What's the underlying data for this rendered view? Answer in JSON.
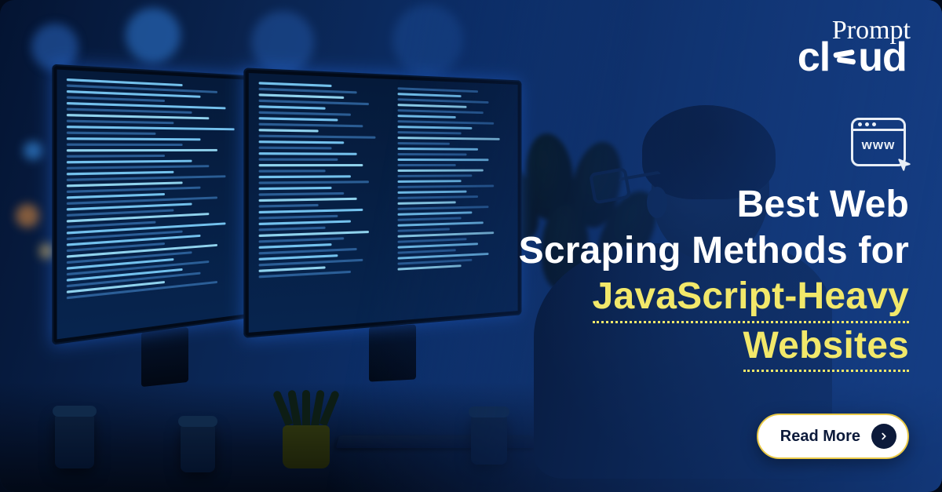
{
  "logo": {
    "top": "Prompt",
    "bottom_prefix": "cl",
    "bottom_suffix": "ud"
  },
  "icon": {
    "www_label": "www"
  },
  "headline": {
    "line1": "Best Web",
    "line2": "Scraping Methods for",
    "line3": "JavaScript-Heavy",
    "line4": "Websites"
  },
  "cta": {
    "label": "Read More"
  }
}
